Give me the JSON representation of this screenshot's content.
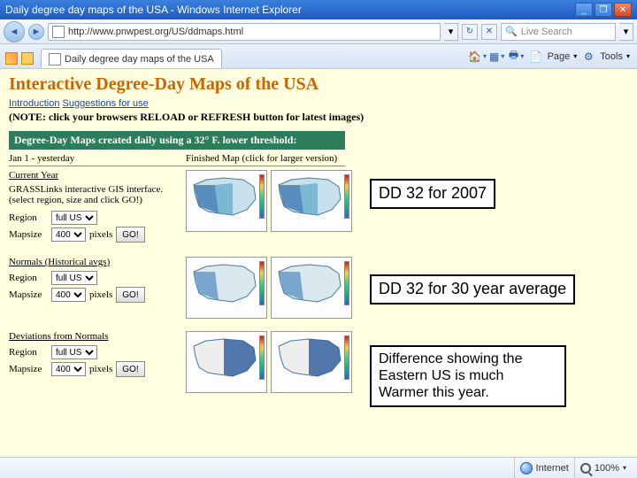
{
  "window": {
    "title": "Daily degree day maps of the USA - Windows Internet Explorer"
  },
  "address": {
    "url": "http://www.pnwpest.org/US/ddmaps.html",
    "search_placeholder": "Live Search"
  },
  "tab": {
    "label": "Daily degree day maps of the USA"
  },
  "toolbar": {
    "page": "Page",
    "tools": "Tools"
  },
  "page": {
    "title": "Interactive Degree-Day Maps of the USA",
    "intro_prefix": "Introduction",
    "intro_suffix": "Suggestions for use",
    "note": "(NOTE: click your browsers RELOAD or REFRESH button for latest images)",
    "greenbar": "Degree-Day Maps created daily using a 32° F. lower threshold:",
    "sub_c1": "Jan 1 - yesterday",
    "sub_c2": "Finished Map (click for larger version)"
  },
  "sections": [
    {
      "title": "Current Year",
      "desc": "GRASSLinks interactive GIS interface. (select region, size and click GO!)",
      "region_label": "Region",
      "region_value": "full US",
      "mapsize_label": "Mapsize",
      "mapsize_value": "400",
      "pixels": "pixels",
      "go": "GO!"
    },
    {
      "title": "Normals (Historical avgs)",
      "desc": "",
      "region_label": "Region",
      "region_value": "full US",
      "mapsize_label": "Mapsize",
      "mapsize_value": "400",
      "pixels": "pixels",
      "go": "GO!"
    },
    {
      "title": "Deviations from Normals",
      "desc": "",
      "region_label": "Region",
      "region_value": "full US",
      "mapsize_label": "Mapsize",
      "mapsize_value": "400",
      "pixels": "pixels",
      "go": "GO!"
    }
  ],
  "annotations": {
    "a1": "DD 32 for 2007",
    "a2": "DD 32 for 30 year average",
    "a3": "Difference showing the Eastern US is much Warmer this year."
  },
  "status": {
    "zone": "Internet",
    "zoom": "100%"
  }
}
